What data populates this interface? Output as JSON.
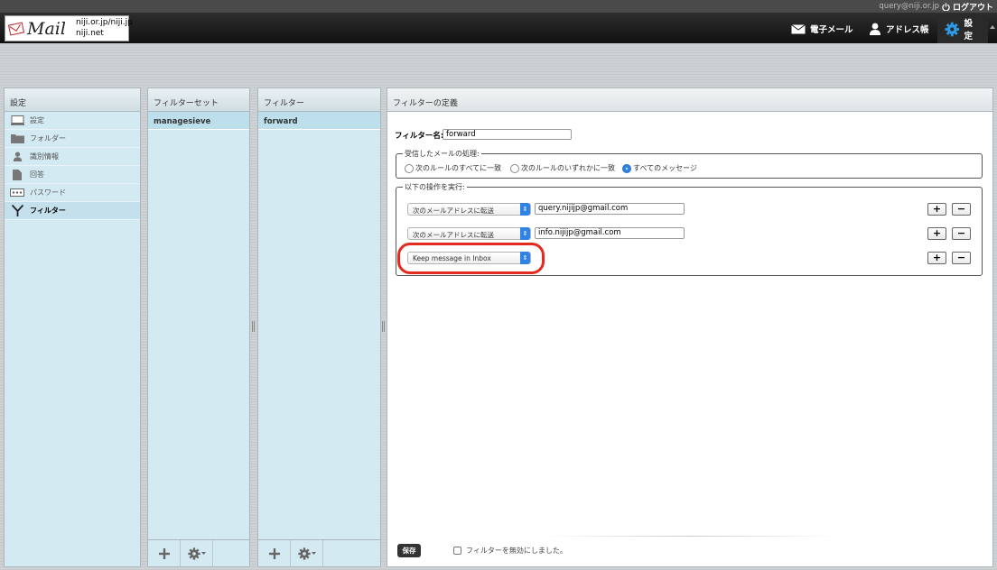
{
  "header": {
    "user_email": "query@niji.or.jp",
    "logout_label": "ログアウト",
    "logo": {
      "text": "Mail",
      "domain1": "niji.or.jp/niji.jp",
      "domain2": "niji.net"
    },
    "nav": [
      {
        "label": "電子メール",
        "icon": "envelope-icon"
      },
      {
        "label": "アドレス帳",
        "icon": "person-icon"
      },
      {
        "label": "設定",
        "icon": "gear-icon",
        "active": true
      }
    ]
  },
  "settings_panel": {
    "title": "設定",
    "items": [
      {
        "label": "設定",
        "icon": "monitor-icon"
      },
      {
        "label": "フォルダー",
        "icon": "folder-icon"
      },
      {
        "label": "識別情報",
        "icon": "person-icon"
      },
      {
        "label": "回答",
        "icon": "document-icon"
      },
      {
        "label": "パスワード",
        "icon": "password-icon"
      },
      {
        "label": "フィルター",
        "icon": "filter-icon",
        "active": true
      }
    ]
  },
  "filterset_panel": {
    "title": "フィルターセット",
    "items": [
      "managesieve"
    ]
  },
  "filter_panel": {
    "title": "フィルター",
    "items": [
      "forward"
    ]
  },
  "definition": {
    "title": "フィルターの定義",
    "name_label": "フィルター名:",
    "name_value": "forward",
    "incoming": {
      "legend": "受信したメールの処理:",
      "options": [
        "次のルールのすべてに一致",
        "次のルールのいずれかに一致",
        "すべてのメッセージ"
      ],
      "selected": 2
    },
    "actions": {
      "legend": "以下の操作を実行:",
      "rows": [
        {
          "action": "次のメールアドレスに転送",
          "target": "query.nijijp@gmail.com"
        },
        {
          "action": "次のメールアドレスに転送",
          "target": "info.nijijp@gmail.com"
        },
        {
          "action": "Keep message in Inbox",
          "target": ""
        }
      ],
      "add_label": "+",
      "remove_label": "−"
    },
    "save_label": "保存",
    "disable_label": "フィルターを無効にしました。",
    "disabled": false
  },
  "colors": {
    "accent": "#2f83e4",
    "highlight": "#e32a1e",
    "panel_bg": "#d3eaf2"
  }
}
